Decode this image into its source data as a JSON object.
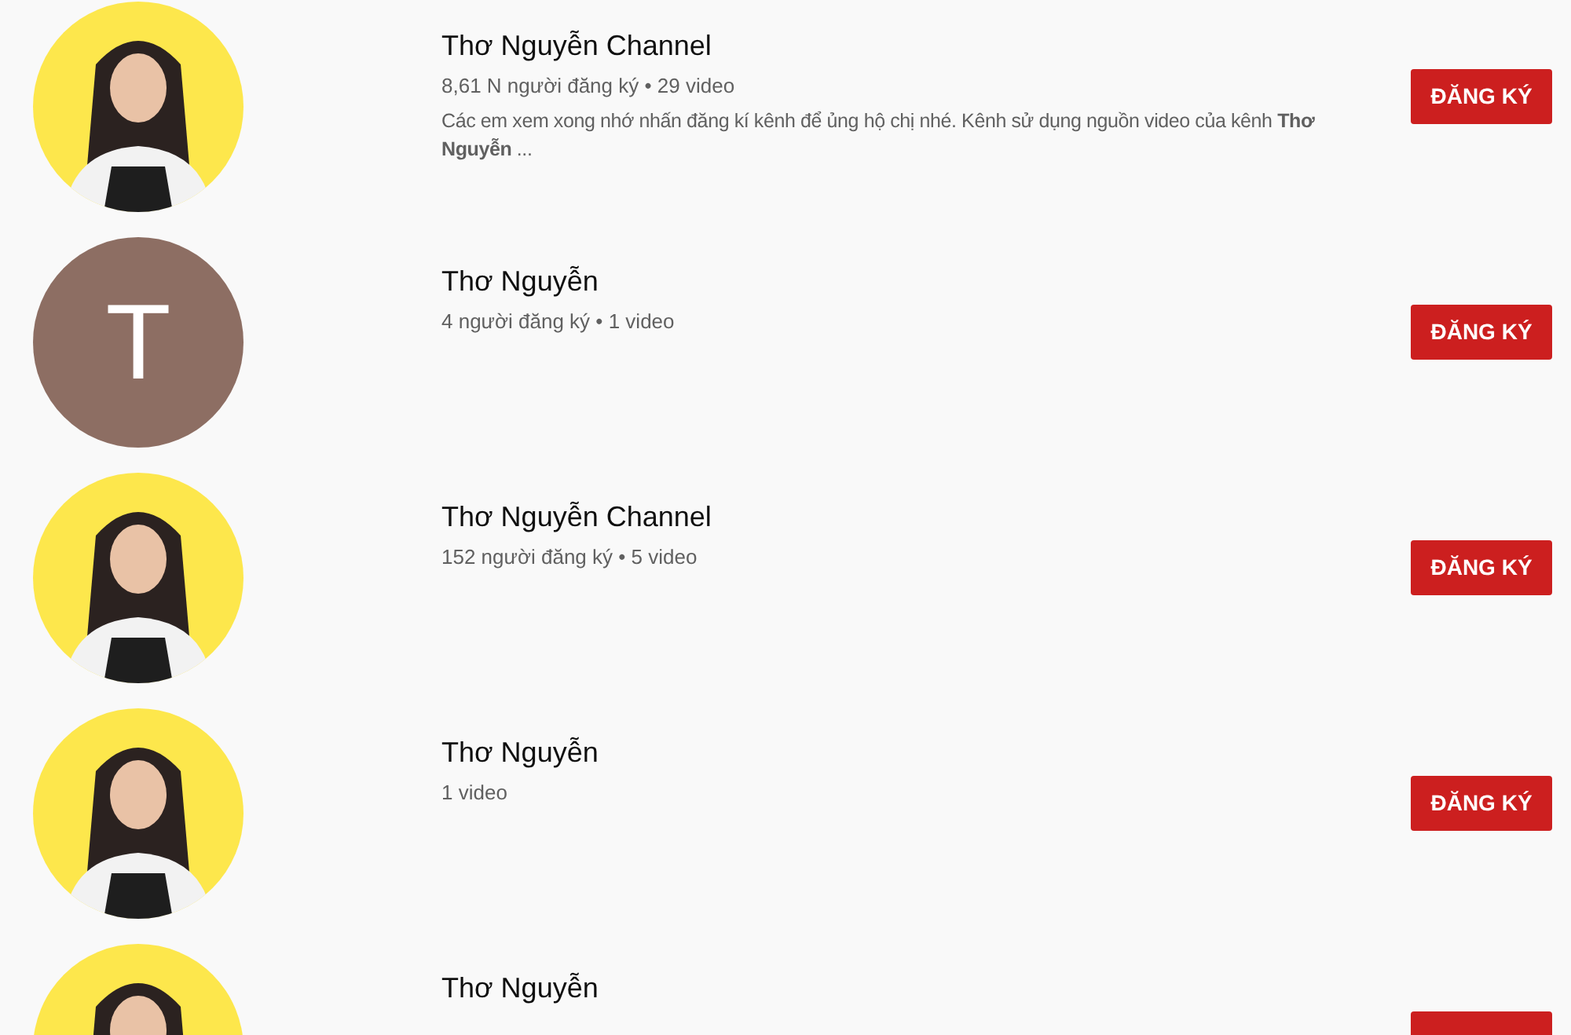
{
  "channels": [
    {
      "name": "Thơ Nguyễn Channel",
      "stats": "8,61 N người đăng ký • 29 video",
      "description": "Các em xem xong nhớ nhấn đăng kí kênh để ủng hộ chị nhé. Kênh sử dụng nguồn video của kênh **Thơ Nguyễn** ...",
      "button": "ĐĂNG KÝ"
    },
    {
      "avatar": {
        "kind": "letter",
        "letter": "T"
      },
      "name": "Thơ Nguyễn",
      "stats": "4 người đăng ký • 1 video",
      "button": "ĐĂNG KÝ"
    },
    {
      "name": "Thơ Nguyễn Channel",
      "stats": "152 người đăng ký • 5 video",
      "button": "ĐĂNG KÝ"
    },
    {
      "name": "Thơ Nguyễn",
      "stats": "1 video",
      "button": "ĐĂNG KÝ"
    },
    {
      "name": "Thơ Nguyễn"
    }
  ]
}
